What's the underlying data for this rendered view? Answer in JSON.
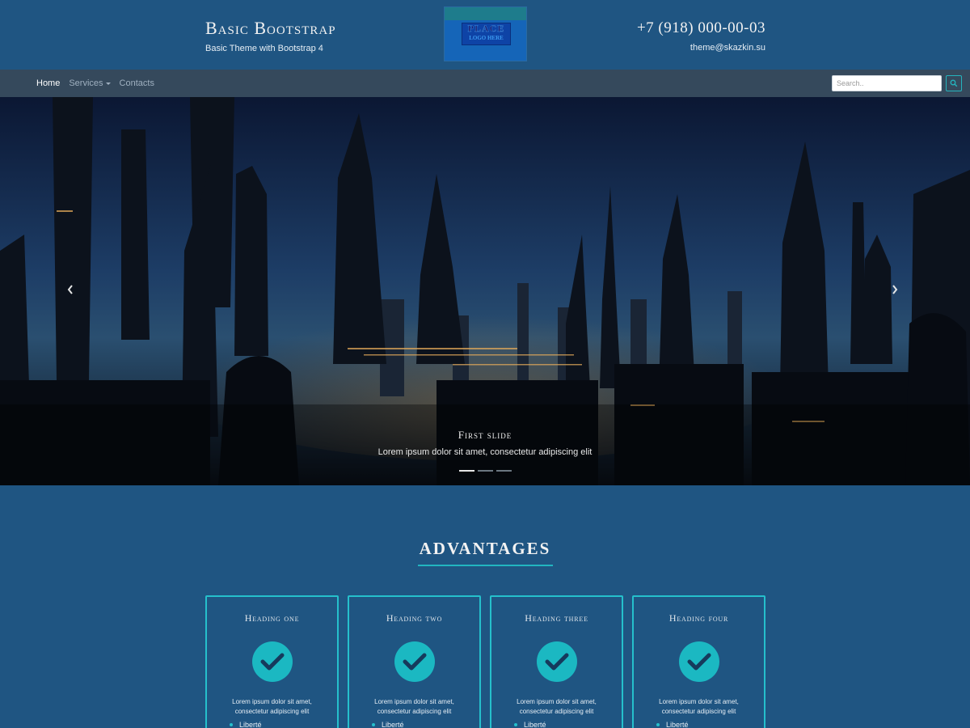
{
  "header": {
    "title": "Basic Bootstrap",
    "subtitle": "Basic Theme with Bootstrap 4",
    "logo_line1": "PLACE",
    "logo_line2": "LOGO HERE",
    "phone": "+7 (918) 000-00-03",
    "email": "theme@skazkin.su"
  },
  "nav": {
    "items": [
      {
        "label": "Home",
        "active": true
      },
      {
        "label": "Services",
        "dropdown": true
      },
      {
        "label": "Contacts"
      }
    ],
    "search_placeholder": "Search..",
    "search_icon": "search-icon"
  },
  "carousel": {
    "slide_title": "First slide",
    "slide_text": "Lorem ipsum dolor sit amet, consectetur adipiscing elit",
    "indicator_count": 3,
    "active_indicator": 0,
    "prev_icon": "chevron-left-icon",
    "next_icon": "chevron-right-icon"
  },
  "advantages": {
    "title": "ADVANTAGES",
    "cards": [
      {
        "heading": "Heading one",
        "text": "Lorem ipsum dolor sit amet, consectetur adipiscing elit",
        "item": "Liberté"
      },
      {
        "heading": "Heading two",
        "text": "Lorem ipsum dolor sit amet, consectetur adipiscing elit",
        "item": "Liberté"
      },
      {
        "heading": "Heading three",
        "text": "Lorem ipsum dolor sit amet, consectetur adipiscing elit",
        "item": "Liberté"
      },
      {
        "heading": "Heading four",
        "text": "Lorem ipsum dolor sit amet, consectetur adipiscing elit",
        "item": "Liberté"
      }
    ]
  },
  "colors": {
    "background": "#1f5582",
    "navbar": "#35495c",
    "accent": "#25c0cc"
  }
}
